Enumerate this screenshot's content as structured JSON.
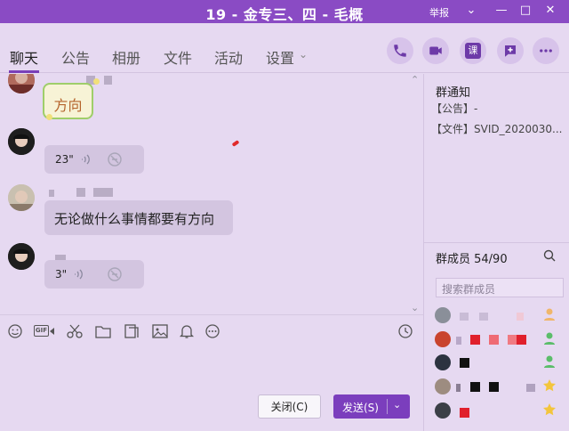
{
  "window": {
    "title": "19 - 金专三、四 - 毛概",
    "report_label": "举报",
    "controls": {
      "menu": "⌄",
      "minimize": "—",
      "maximize": "□",
      "close": "✕"
    }
  },
  "tabs": [
    {
      "label": "聊天",
      "active": true
    },
    {
      "label": "公告",
      "active": false
    },
    {
      "label": "相册",
      "active": false
    },
    {
      "label": "文件",
      "active": false
    },
    {
      "label": "活动",
      "active": false
    },
    {
      "label": "设置",
      "active": false
    }
  ],
  "tab_dropdown_glyph": "⌄",
  "tab_buttons": [
    "phone-icon",
    "video-icon",
    "lesson-icon",
    "add-app-icon",
    "more-icon"
  ],
  "tab_button_lesson_label": "课",
  "messages": [
    {
      "type": "text",
      "text": "方向"
    },
    {
      "type": "voice",
      "duration": "23\""
    },
    {
      "type": "text",
      "text": "无论做什么事情都要有方向"
    },
    {
      "type": "voice",
      "duration": "3\""
    }
  ],
  "toolbar_icons": [
    "emoji-icon",
    "gif-icon",
    "scissors-icon",
    "folder-icon",
    "image-file-icon",
    "picture-icon",
    "bell-icon",
    "more-circle-icon",
    "history-clock-icon"
  ],
  "toolbar_gif_label": "GIF",
  "buttons": {
    "close_label": "关闭(C)",
    "send_label": "发送(S)",
    "send_dropdown": "⌄"
  },
  "right_panel": {
    "notice_title": "群通知",
    "notice_announcement": "【公告】-",
    "notice_file": "【文件】SVID_2020030...",
    "members_title": "群成员 54/90",
    "search_placeholder": "搜索群成员"
  },
  "colors": {
    "titlebar": "#8a4bc4",
    "accent": "#7b3ebd",
    "background": "#e6d9f1",
    "bubble": "#d3c5e0",
    "redaction_red": "#e0202c"
  }
}
